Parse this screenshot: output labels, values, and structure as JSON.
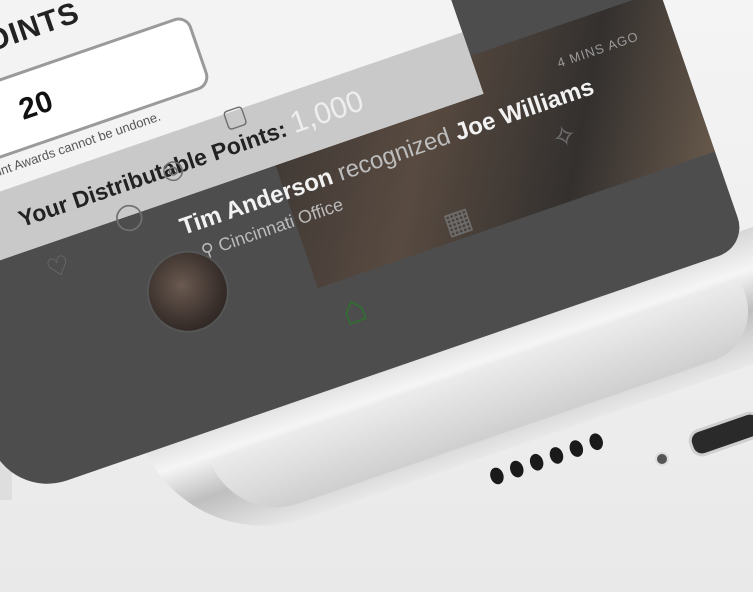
{
  "modal": {
    "title": "AWARD POINTS",
    "points_value": "20",
    "confirm_icon": "checkmark-icon",
    "undo_note": "Point Awards cannot be undone.",
    "distributable_label": "Your Distributable Points:",
    "distributable_value": "1,000"
  },
  "post": {
    "author": "Tim Anderson",
    "verb": "recognized",
    "recipient": "Joe Williams",
    "time": "4 MINS AGO",
    "location": "Cincinnati Office"
  },
  "nav": {
    "items": [
      {
        "icon": "home-icon"
      },
      {
        "icon": "calendar-icon"
      },
      {
        "icon": "megaphone-icon"
      }
    ]
  },
  "colors": {
    "confirm": "#1f9a2b",
    "active_nav": "#2f6f31",
    "modal_bg": "#f3f3f3",
    "overlay": "#4d4d4d"
  }
}
